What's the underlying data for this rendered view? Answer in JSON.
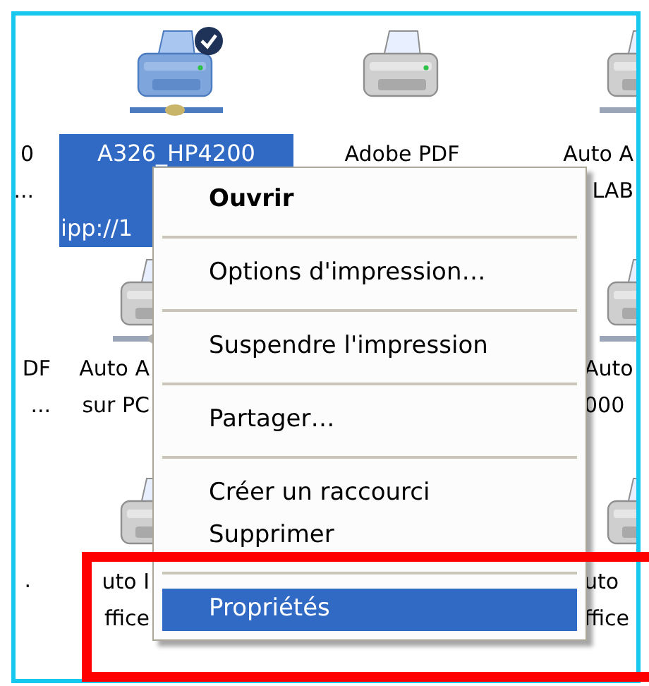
{
  "icons": [
    {
      "label_lines": [
        "0",
        "..."
      ],
      "selected": false
    },
    {
      "kind": "network_printer",
      "label_lines": [
        "A326_HP4200",
        "ipp://1"
      ],
      "selected": true,
      "default_badge": true
    },
    {
      "kind": "printer",
      "label_lines": [
        "Adobe PDF"
      ],
      "selected": false
    },
    {
      "kind": "network_printer",
      "label_lines": [
        "Auto A",
        "LAB"
      ],
      "selected": false
    },
    {
      "label_lines": [
        "DF",
        "..."
      ],
      "selected": false
    },
    {
      "kind": "network_printer",
      "label_lines": [
        "Auto A",
        "sur PC"
      ],
      "selected": false
    },
    {
      "kind": "network_printer",
      "label_lines": [
        "Auto",
        "000"
      ],
      "selected": false
    },
    {
      "label_lines": [
        "."
      ],
      "selected": false
    },
    {
      "kind": "network_printer",
      "label_lines": [
        "uto I",
        "ffice"
      ],
      "selected": false
    },
    {
      "kind": "network_printer",
      "label_lines": [
        "uto",
        "ffice"
      ],
      "selected": false
    }
  ],
  "context_menu": {
    "items": [
      {
        "kind": "item",
        "label": "Ouvrir",
        "bold": true,
        "selected": false
      },
      {
        "kind": "separator"
      },
      {
        "kind": "item",
        "label": "Options d'impression…",
        "bold": false,
        "selected": false
      },
      {
        "kind": "separator"
      },
      {
        "kind": "item",
        "label": "Suspendre l'impression",
        "bold": false,
        "selected": false
      },
      {
        "kind": "separator"
      },
      {
        "kind": "item",
        "label": "Partager…",
        "bold": false,
        "selected": false
      },
      {
        "kind": "separator"
      },
      {
        "kind": "item",
        "label": "Créer un raccourci",
        "bold": false,
        "selected": false
      },
      {
        "kind": "item",
        "label": "Supprimer",
        "bold": false,
        "selected": false
      },
      {
        "kind": "separator"
      },
      {
        "kind": "item",
        "label": "Propriétés",
        "bold": false,
        "selected": true
      }
    ]
  }
}
